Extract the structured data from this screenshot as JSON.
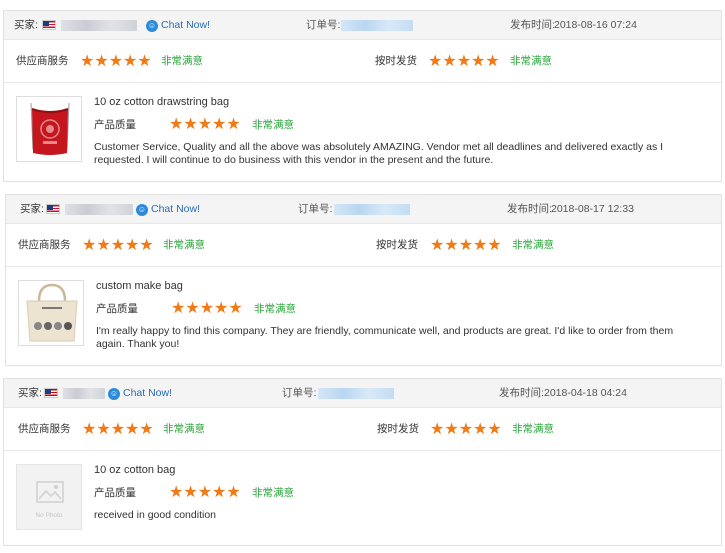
{
  "labels": {
    "buyer": "买家:",
    "chat": "Chat Now!",
    "order_no": "订单号:",
    "publish_time": "发布时间:",
    "supplier_service": "供应商服务",
    "on_time_delivery": "按时发货",
    "product_quality": "产品质量",
    "very_satisfied": "非常满意",
    "no_photo": "No Photo"
  },
  "star_glyphs": "★★★★★",
  "colors": {
    "star": "#f07a15",
    "satisfied": "#29a539",
    "chat_link": "#2b6cb8"
  },
  "reviews": [
    {
      "buyer_flag": "us-flag-icon",
      "publish_time": "2018-08-16 07:24",
      "supplier_rating": 5,
      "delivery_rating": 5,
      "product_name": "10 oz cotton drawstring bag",
      "quality_rating": 5,
      "text": "Customer Service, Quality and all the above was absolutely AMAZING. Vendor met all deadlines and delivered exactly as I requested. I will continue to do business with this vendor in the present and the future."
    },
    {
      "buyer_flag": "us-flag-icon",
      "publish_time": "2018-08-17 12:33",
      "supplier_rating": 5,
      "delivery_rating": 5,
      "product_name": "custom make bag",
      "quality_rating": 5,
      "text": "I'm really happy to find this company. They are friendly, communicate well, and products are great. I'd like to order from them again. Thank you!"
    },
    {
      "buyer_flag": "my-flag-icon",
      "publish_time": "2018-04-18 04:24",
      "supplier_rating": 5,
      "delivery_rating": 5,
      "product_name": "10 oz cotton bag",
      "quality_rating": 5,
      "text": "received in good condition"
    }
  ]
}
